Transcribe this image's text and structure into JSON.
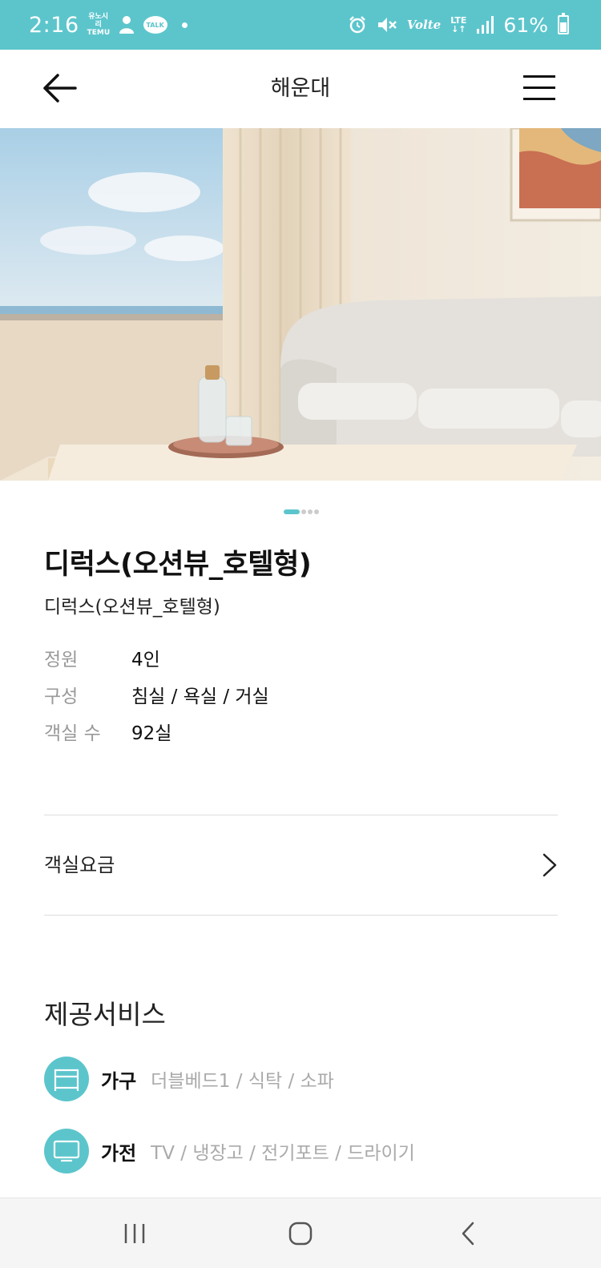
{
  "status_bar": {
    "time": "2:16",
    "notif_label_line1": "유노시리",
    "notif_label_line2": "TEMU",
    "talk_label": "TALK",
    "volte_label": "Volte",
    "lte_label": "LTE",
    "battery_text": "61%",
    "battery_level": 0.61,
    "icons": [
      "person-icon",
      "talk-icon",
      "alarm-icon",
      "mute-icon",
      "signal-icon",
      "battery-icon"
    ]
  },
  "header": {
    "title": "해운대",
    "back_icon": "arrow-left-icon",
    "menu_icon": "hamburger-menu-icon"
  },
  "carousel": {
    "total": 4,
    "active": 1
  },
  "room": {
    "title": "디럭스(오션뷰_호텔형)",
    "subtitle": "디럭스(오션뷰_호텔형)",
    "specs": [
      {
        "label": "정원",
        "value": "4인"
      },
      {
        "label": "구성",
        "value": "침실 / 욕실 / 거실"
      },
      {
        "label": "객실 수",
        "value": "92실"
      }
    ]
  },
  "price": {
    "label": "객실요금",
    "chevron_icon": "chevron-right-icon"
  },
  "services": {
    "heading": "제공서비스",
    "items": [
      {
        "label": "가구",
        "items": "더블베드1 / 식탁 / 소파",
        "icon": "bed-icon"
      },
      {
        "label": "가전",
        "items": "TV / 냉장고 / 전기포트 / 드라이기",
        "icon": "tv-icon"
      }
    ]
  },
  "colors": {
    "accent": "#5cc5cc",
    "text_primary": "#111111",
    "text_muted": "#999999",
    "divider": "#dddddd"
  }
}
